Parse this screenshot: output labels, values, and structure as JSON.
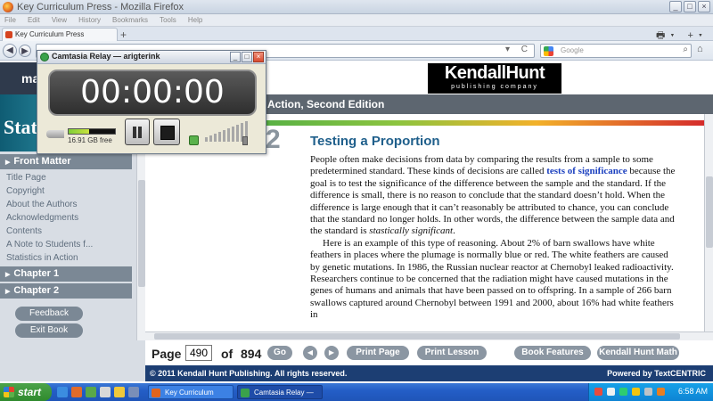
{
  "window": {
    "title": "Key Curriculum Press - Mozilla Firefox",
    "controls": [
      "_",
      "□",
      "×"
    ]
  },
  "menu": [
    "File",
    "Edit",
    "View",
    "History",
    "Bookmarks",
    "Tools",
    "Help"
  ],
  "tab": {
    "label": "Key Curriculum Press",
    "new_tab": "+"
  },
  "toolbar": {
    "back": "◀",
    "forward": "▶",
    "url_controls": "▾ C",
    "search_placeholder": "Google",
    "search_icon": "⌕",
    "home_icon": "⌂"
  },
  "header": {
    "brand": "KendallHunt",
    "brand_sub": "publishing company",
    "left_logo_text": "mat"
  },
  "book_title": "Action, Second Edition",
  "sidebar": {
    "cover_text": "Stat",
    "front_matter": "Front Matter",
    "items": [
      "Title Page",
      "Copyright",
      "About the Authors",
      "Acknowledgments",
      "Contents",
      "A Note to Students f...",
      "Statistics in Action"
    ],
    "chapter1": "Chapter 1",
    "chapter2": "Chapter 2",
    "feedback": "Feedback",
    "exit": "Exit Book"
  },
  "content": {
    "chapter_number": "2",
    "section_title": "Testing a Proportion",
    "p1_a": "People often make decisions from data by comparing the results from a sample to some predetermined standard. These kinds of decisions are called ",
    "p1_kw": "tests of significance",
    "p1_b": " because the goal is to test the significance of the difference between the sample and the standard. If the difference is small, there is no reason to conclude that the standard doesn’t hold. When the difference is large enough that it can’t reasonably be attributed to chance, you can conclude that the standard no longer holds. In other words, the difference between the sample data and the standard is ",
    "p1_it": "stastically significant",
    "p1_end": ".",
    "p2": "Here is an example of this type of reasoning. About 2% of barn swallows have white feathers in places where the plumage is normally blue or red. The white feathers are caused by genetic mutations. In 1986, the Russian nuclear reactor at Chernobyl leaked radioactivity. Researchers continue to be concerned that the radiation might have caused mutations in the genes of humans and animals that have been passed on to offspring. In a sample of 266 barn swallows captured around Chernobyl between 1991 and 2000, about 16% had white feathers in"
  },
  "pagenav": {
    "page_label": "Page",
    "page_value": "490",
    "of_label": "of",
    "total": "894",
    "go": "Go",
    "print_page": "Print Page",
    "print_lesson": "Print Lesson",
    "book_features": "Book Features",
    "kh_math": "Kendall Hunt Math"
  },
  "footer": {
    "copyright": "© 2011 Kendall Hunt Publishing. All rights reserved.",
    "powered": "Powered by TextCENTRIC"
  },
  "camtasia": {
    "title": "Camtasia Relay — arigterink",
    "timer": "00:00:00",
    "disk_free": "16.91 GB free",
    "level_fraction": 0.45
  },
  "taskbar": {
    "start": "start",
    "tasks": [
      "Key Curriculum Press ...",
      "Camtasia Relay — ari..."
    ],
    "clock": "6:58 AM"
  }
}
